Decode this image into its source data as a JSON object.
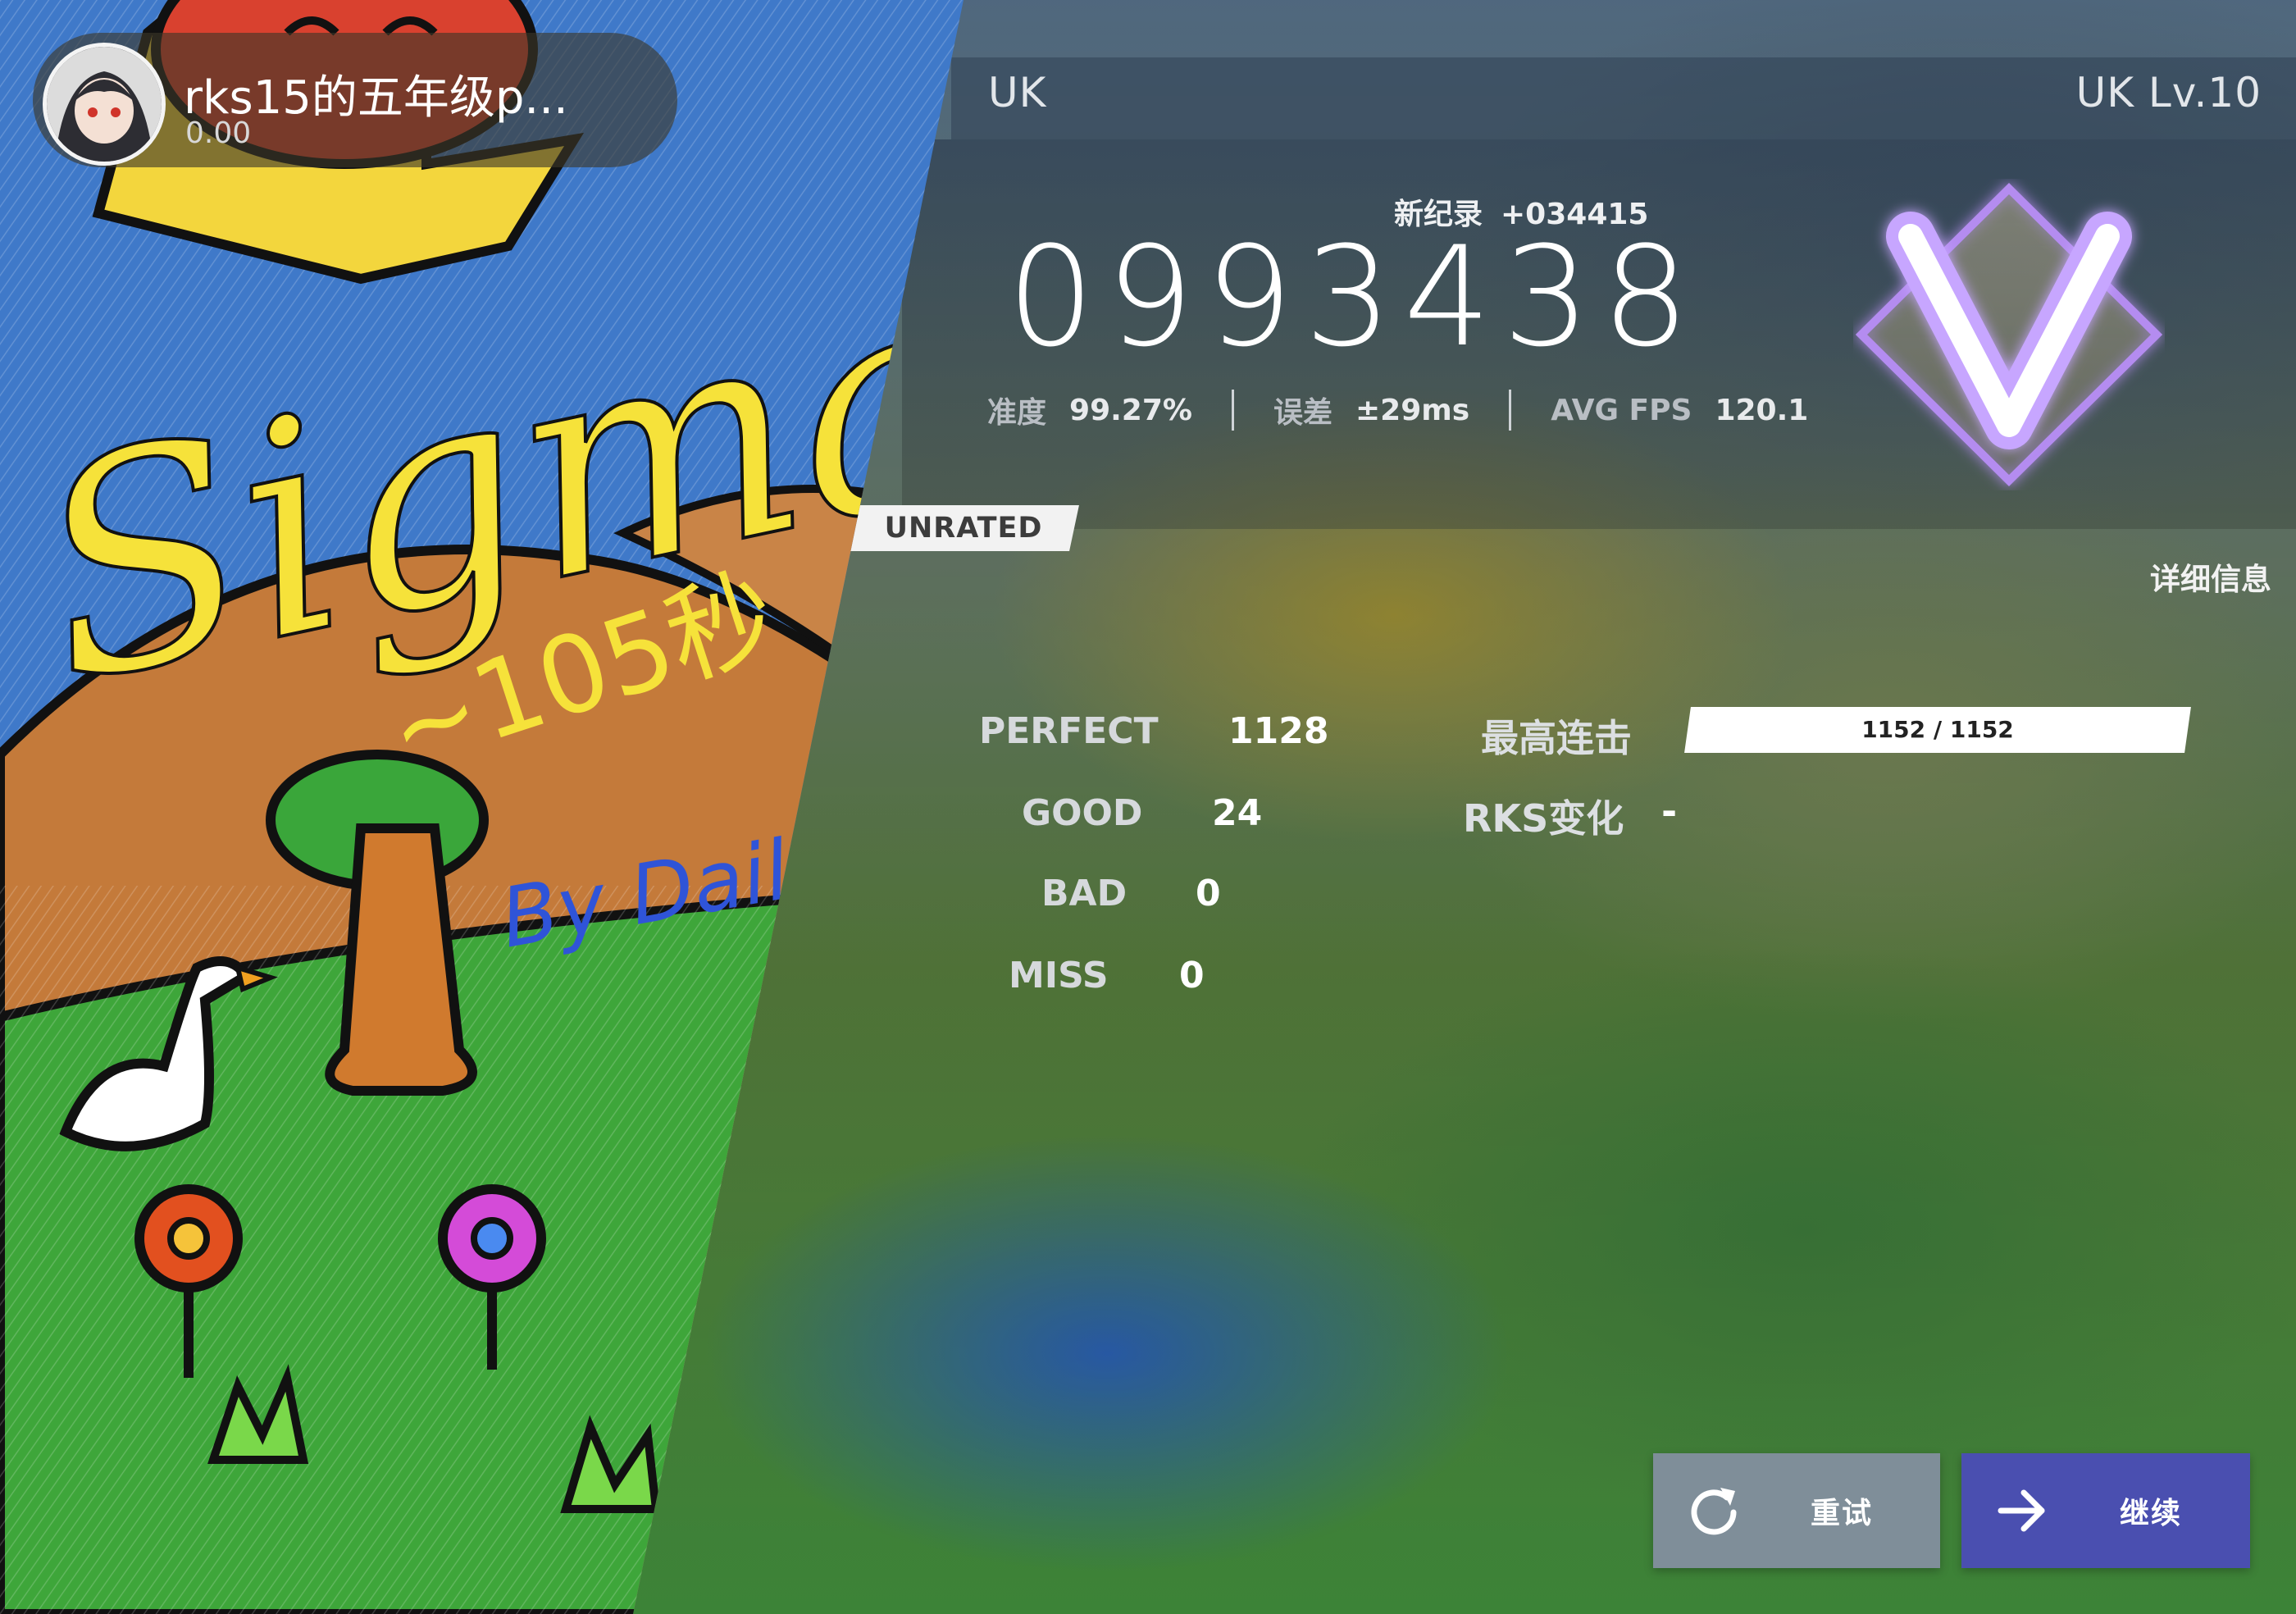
{
  "player": {
    "name": "rks15的五年级p...",
    "rks": "0.00"
  },
  "song": {
    "name": "UK",
    "level": "UK Lv.10"
  },
  "score": {
    "new_record_label": "新纪录",
    "delta": "+034415",
    "value": "0993438",
    "grade": "V",
    "accuracy_label": "准度",
    "accuracy": "99.27%",
    "error_label": "误差",
    "error": "±29ms",
    "fps_label": "AVG FPS",
    "fps": "120.1"
  },
  "unrated": "UNRATED",
  "details_link": "详细信息",
  "judgements": {
    "perfect_label": "PERFECT",
    "perfect": "1128",
    "good_label": "GOOD",
    "good": "24",
    "bad_label": "BAD",
    "bad": "0",
    "miss_label": "MISS",
    "miss": "0"
  },
  "combo": {
    "label": "最高连击",
    "value": "1152 / 1152",
    "fraction": 1.0
  },
  "rks_change": {
    "label": "RKS变化",
    "value": "-"
  },
  "buttons": {
    "retry": "重试",
    "continue": "继续"
  },
  "artwork": {
    "title_text": "Sigma",
    "subtitle_text": "~105秒",
    "credit_text": "By Daily"
  },
  "colors": {
    "continue_button": "#4a4fb0",
    "retry_button": "#7f8e99",
    "grade_glow": "#b48cf0"
  },
  "icons": {
    "retry": "refresh-icon",
    "continue": "arrow-right-icon"
  }
}
